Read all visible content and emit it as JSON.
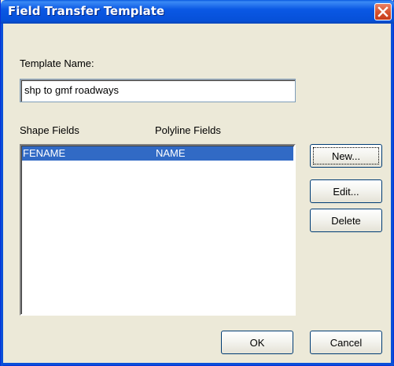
{
  "window": {
    "title": "Field Transfer Template"
  },
  "template_name": {
    "label": "Template Name:",
    "value": "shp to gmf roadways"
  },
  "fields_list": {
    "columns": [
      "Shape Fields",
      "Polyline Fields"
    ],
    "rows": [
      {
        "shape_field": "FENAME",
        "polyline_field": "NAME",
        "selected": true
      }
    ]
  },
  "buttons": {
    "new": "New...",
    "edit": "Edit...",
    "delete": "Delete",
    "ok": "OK",
    "cancel": "Cancel"
  },
  "icons": {
    "close": "close-icon"
  },
  "colors": {
    "title_bar": "#0a58e4",
    "selection": "#316ac5",
    "dialog_bg": "#ece9d8",
    "close_button": "#d5512c"
  }
}
